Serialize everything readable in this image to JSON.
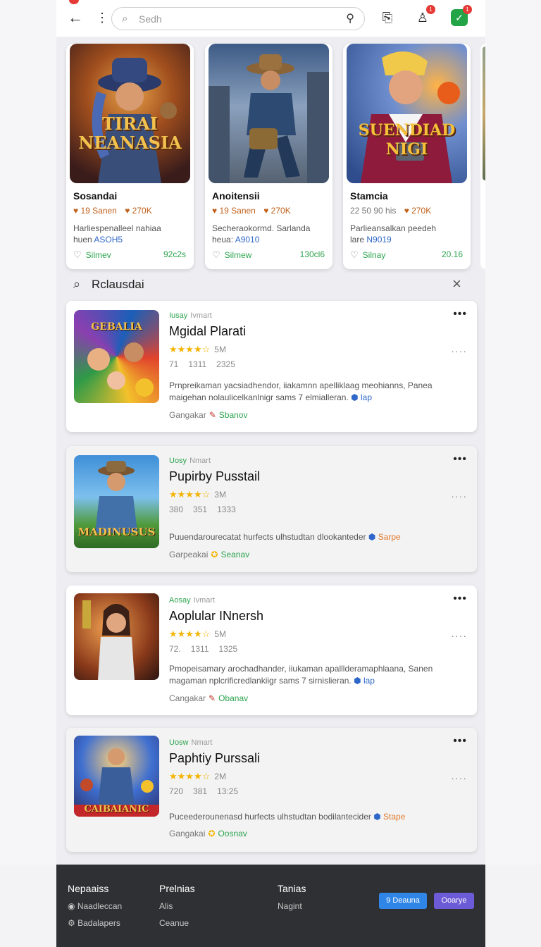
{
  "topbar": {
    "search_placeholder": "Sedh",
    "icons": [
      "back-arrow-icon",
      "kebab-icon",
      "search-icon",
      "mic-icon",
      "bookmark-icon",
      "user-icon",
      "shield-icon"
    ],
    "user_badge": "1",
    "shield_badge": "1"
  },
  "featured": [
    {
      "art_title": "TIRAI NEANASIA",
      "name": "Sosandai",
      "stat1": "19 Sanen",
      "stat2": "270K",
      "desc": "Harliespenalleel nahiaa",
      "desc_prefix": "huen",
      "desc_link": "ASOH5",
      "foot_left": "Silmev",
      "foot_right": "92c2s"
    },
    {
      "art_title": "",
      "name": "Anoitensii",
      "stat1": "19 Sanen",
      "stat2": "270K",
      "desc": "Secheraokormd. Sarlanda",
      "desc_prefix": "heua:",
      "desc_link": "A9010",
      "foot_left": "Silmew",
      "foot_right": "130cl6"
    },
    {
      "art_title": "SUENDIAD NIGI",
      "name": "Stamcia",
      "stat1": "22 50 90 his",
      "stat2": "270K",
      "desc": "Parlieansalkan peedeh",
      "desc_prefix": "lare",
      "desc_link": "N9019",
      "foot_left": "Silnay",
      "foot_right": "20.16"
    }
  ],
  "section": {
    "title": "Rclausdai"
  },
  "list": [
    {
      "thumb_title": "GEBALIA",
      "cat": "Iusay",
      "cat2": "Ivmart",
      "title": "Mgidal Plarati",
      "count": "5M",
      "nums": [
        "71",
        "1311",
        "2325"
      ],
      "desc1": "Prnpreikaman yacsiadhendor, iiakamnn apelliklaag meohianns, Panea",
      "desc2": "maigehan nolaulicelkanlnigr sams 7 elmialleran.",
      "desc_link": "lap",
      "foot_label": "Gangakar",
      "foot_green": "Sbanov"
    },
    {
      "thumb_title": "MADINUSUS",
      "cat": "Uosy",
      "cat2": "Nmart",
      "title": "Pupirby Pusstail",
      "count": "3M",
      "nums": [
        "380",
        "351",
        "1333"
      ],
      "desc1": "Puuendarourecatat hurfects ulhstudtan dlookanteder",
      "desc2": "",
      "desc_link": "Sarpe",
      "foot_label": "Garpeakai",
      "foot_green": "Seanav"
    },
    {
      "thumb_title": "",
      "cat": "Aosay",
      "cat2": "Ivmart",
      "title": "Aoplular INnersh",
      "count": "5M",
      "nums": [
        "72.",
        "1311",
        "1325"
      ],
      "desc1": "Pmopeisamary arochadhander, iiukaman apalllderamaphlaana, Sanen",
      "desc2": "magaman nplcrificredlankiigr sams 7 sirnislieran.",
      "desc_link": "lap",
      "foot_label": "Cangakar",
      "foot_green": "Obanav"
    },
    {
      "thumb_title": "CAIBAIANIC",
      "cat": "Uosw",
      "cat2": "Nmart",
      "title": "Paphtiy Purssali",
      "count": "2M",
      "nums": [
        "720",
        "381",
        "13:25"
      ],
      "desc1": "Puceederounenasd hurfects ulhstudtan bodilantecider",
      "desc2": "",
      "desc_link": "Stape",
      "foot_label": "Gangakai",
      "foot_green": "Oosnav"
    }
  ],
  "footer": {
    "col1": "Nepaaiss",
    "col1_items": [
      "Naadleccan",
      "Badalapers"
    ],
    "col2": "Prelnias",
    "col2_items": [
      "Alis",
      "Ceanue"
    ],
    "col3": "Tanias",
    "col3_items": [
      "Nagint"
    ],
    "btn1": "9 Deauna",
    "btn2": "Ooarye"
  },
  "colors": {
    "green": "#2ea44f",
    "link_blue": "#2e67c9",
    "orange": "#c0601a",
    "footer_bg": "#2f3033",
    "btn_blue": "#2f86e6",
    "btn_purple": "#6b5bd6"
  }
}
